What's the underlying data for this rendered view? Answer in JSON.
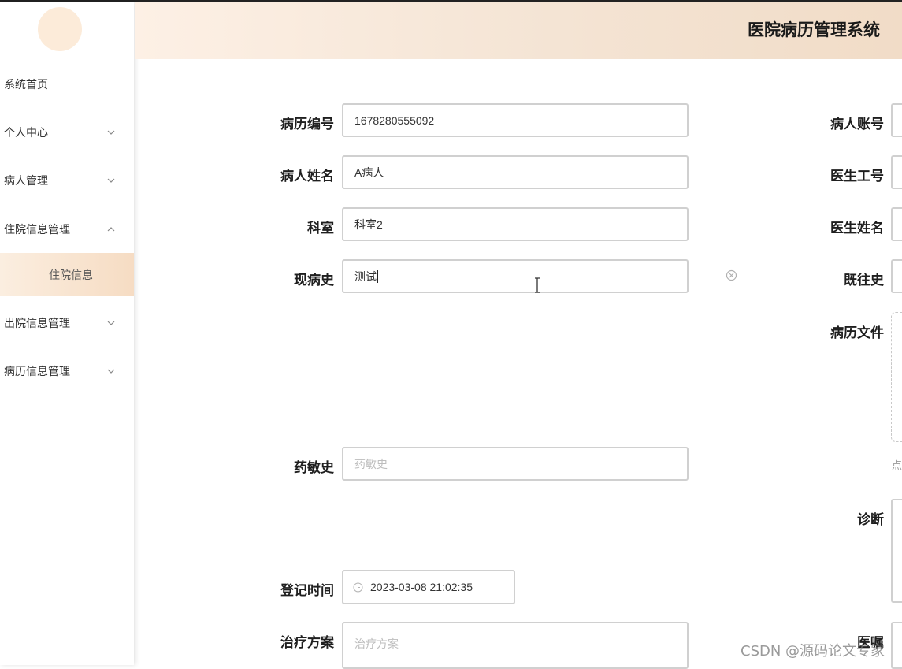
{
  "header": {
    "title": "医院病历管理系统"
  },
  "sidebar": {
    "items": [
      {
        "label": "系统首页"
      },
      {
        "label": "个人中心"
      },
      {
        "label": "病人管理"
      },
      {
        "label": "住院信息管理"
      },
      {
        "label": "出院信息管理"
      },
      {
        "label": "病历信息管理"
      }
    ],
    "sub_item": {
      "label": "住院信息"
    }
  },
  "form": {
    "record_no": {
      "label": "病历编号",
      "value": "1678280555092"
    },
    "patient_name": {
      "label": "病人姓名",
      "value": "A病人"
    },
    "department": {
      "label": "科室",
      "value": "科室2"
    },
    "present_illness": {
      "label": "现病史",
      "value": "测试"
    },
    "allergy": {
      "label": "药敏史",
      "placeholder": "药敏史"
    },
    "register_time": {
      "label": "登记时间",
      "value": "2023-03-08 21:02:35"
    },
    "treatment": {
      "label": "治疗方案",
      "placeholder": "治疗方案"
    },
    "patient_account": {
      "label": "病人账号"
    },
    "doctor_id": {
      "label": "医生工号"
    },
    "doctor_name": {
      "label": "医生姓名"
    },
    "past_history": {
      "label": "既往史"
    },
    "record_file": {
      "label": "病历文件",
      "hint": "点"
    },
    "diagnosis": {
      "label": "诊断"
    },
    "medical_order": {
      "label": "医嘱"
    }
  },
  "watermark": "CSDN @源码论文专家"
}
